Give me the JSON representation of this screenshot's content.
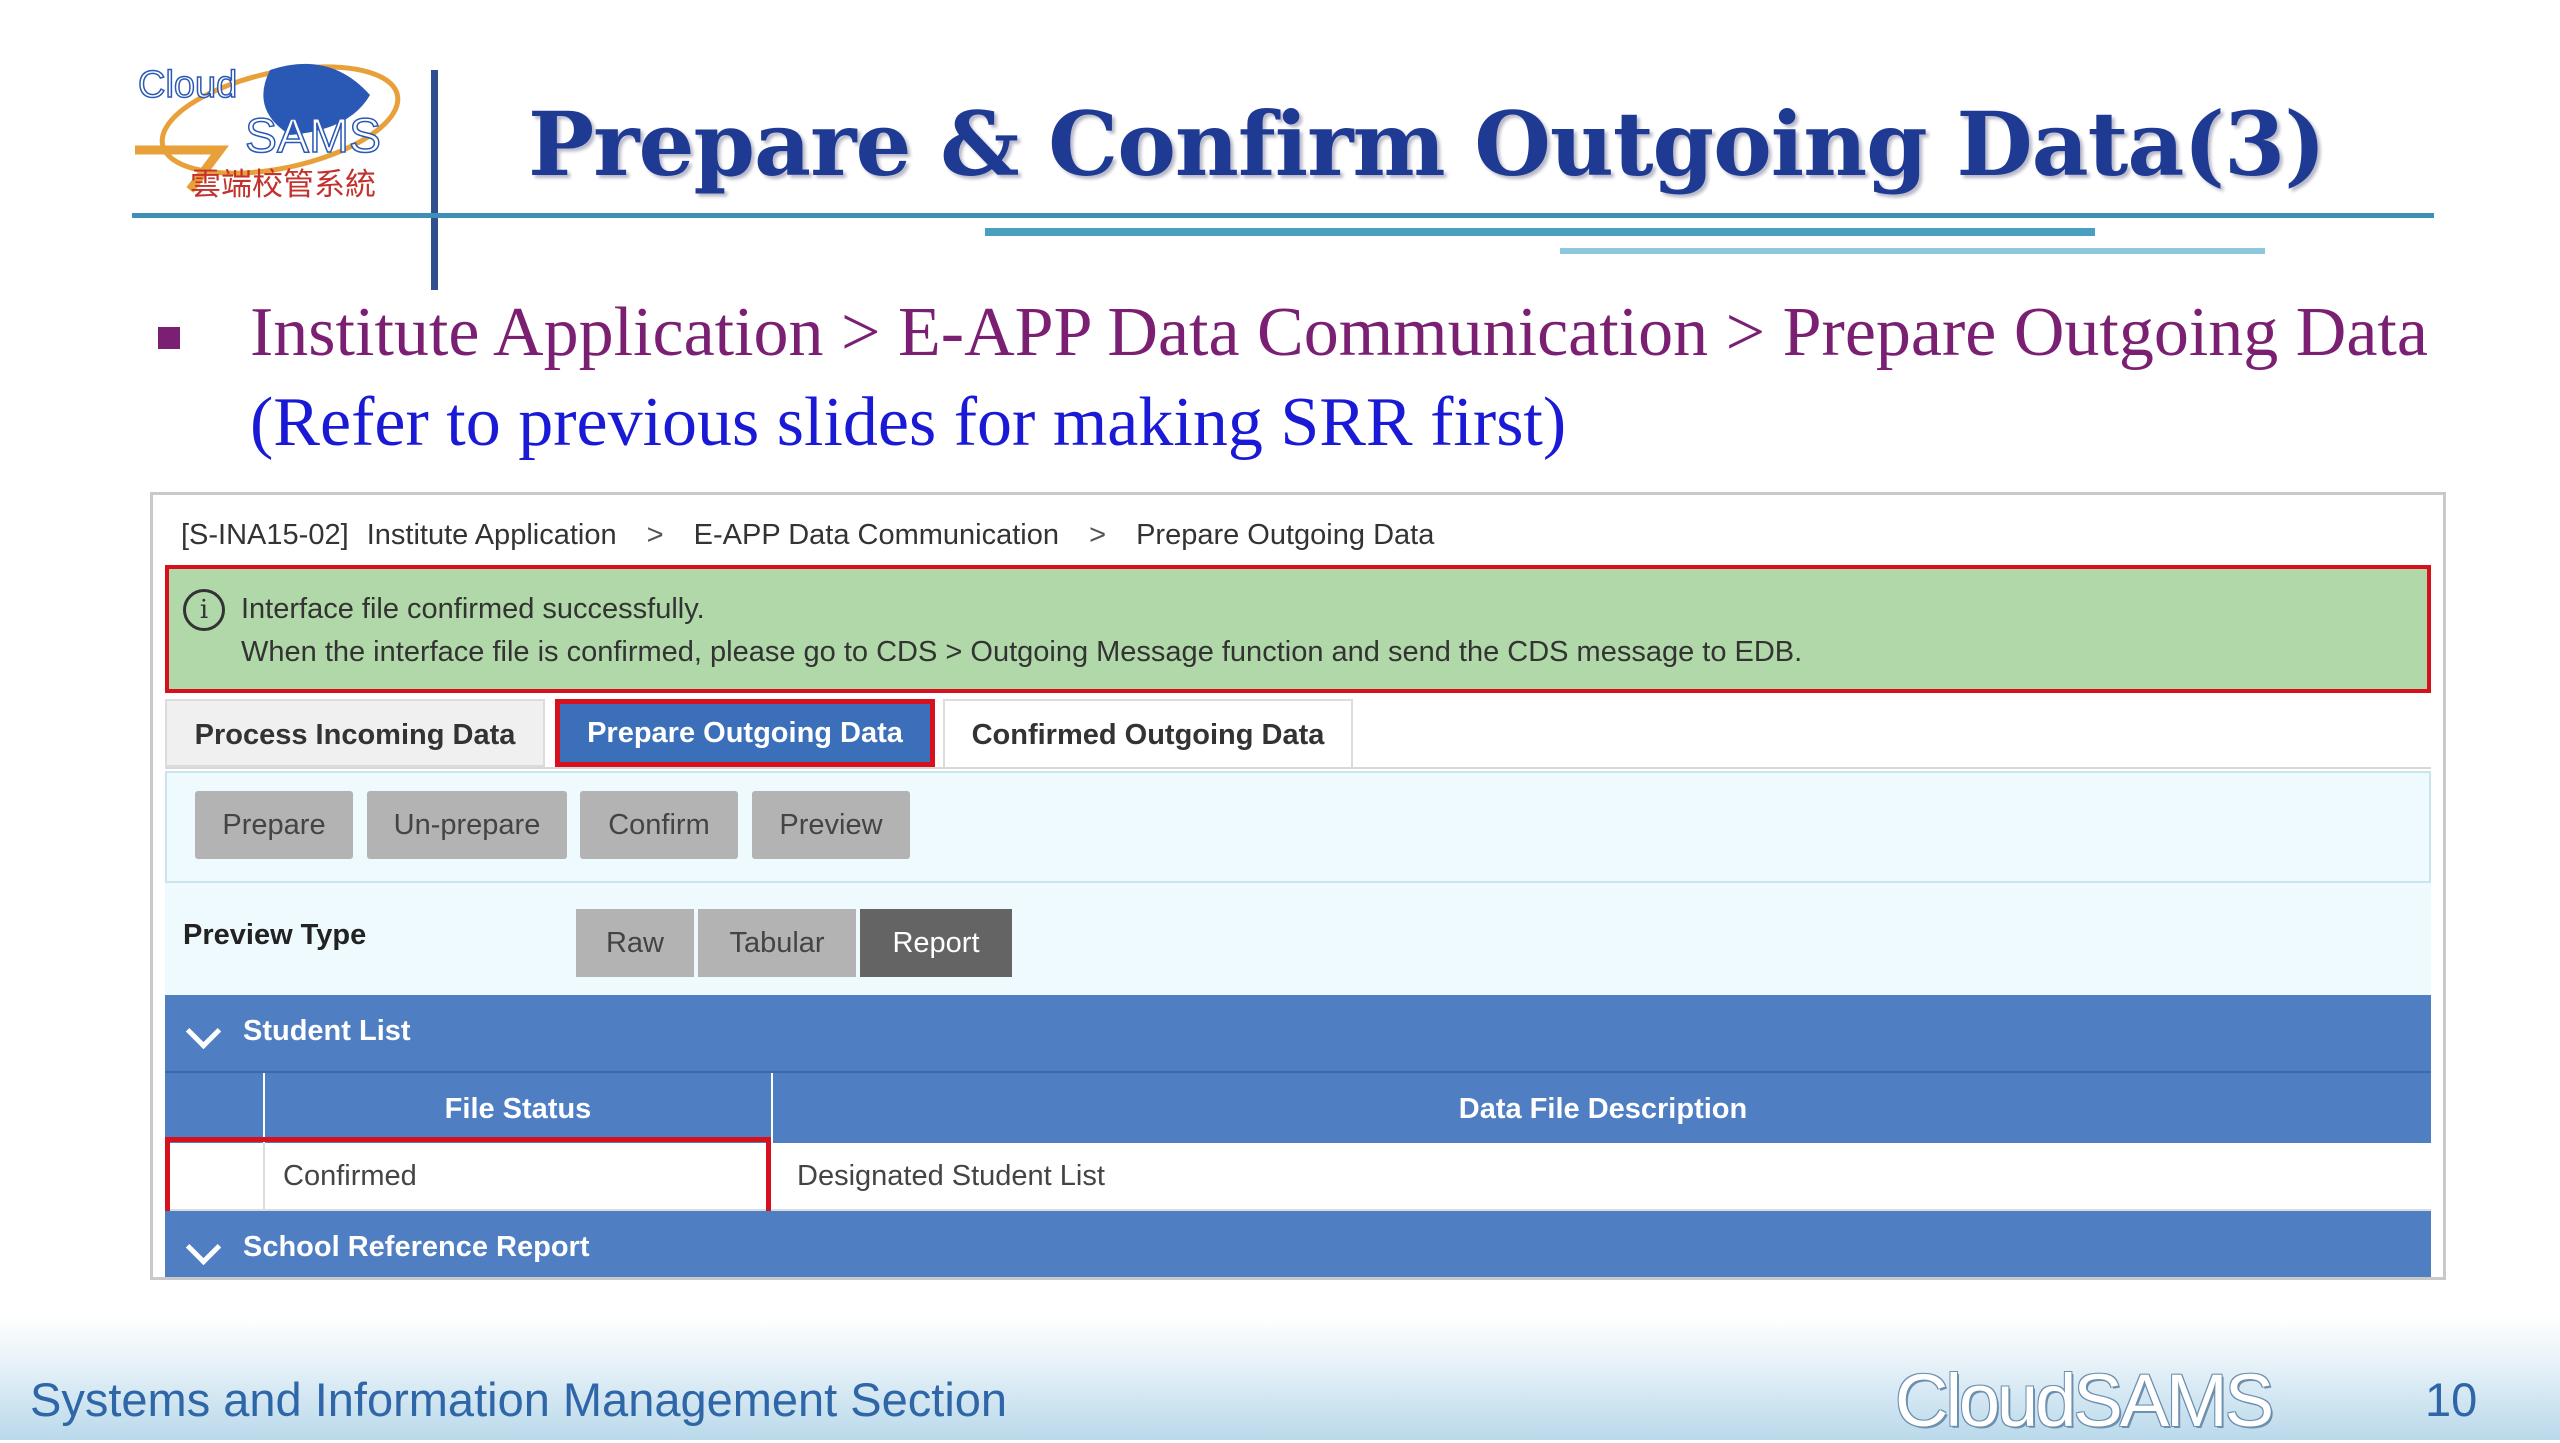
{
  "slide": {
    "title": "Prepare & Confirm Outgoing Data(3)",
    "bullet_path": "Institute Application > E-APP Data Communication > Prepare Outgoing Data",
    "bullet_note": "(Refer to previous slides for making SRR first)",
    "logo": {
      "text_en_1": "Cloud",
      "text_en_2": "SAMS",
      "text_zh": "雲端校管系統"
    }
  },
  "app": {
    "breadcrumb": {
      "code": "[S-INA15-02]",
      "items": [
        "Institute Application",
        "E-APP Data Communication",
        "Prepare Outgoing Data"
      ],
      "separator": ">"
    },
    "alert": {
      "icon": "info-icon",
      "line1": "Interface file confirmed successfully.",
      "line2": "When the interface file is confirmed, please go to CDS > Outgoing Message function and send the CDS message to EDB."
    },
    "tabs": [
      {
        "label": "Process Incoming Data",
        "active": false
      },
      {
        "label": "Prepare Outgoing Data",
        "active": true
      },
      {
        "label": "Confirmed Outgoing Data",
        "active": false
      }
    ],
    "actions": [
      "Prepare",
      "Un-prepare",
      "Confirm",
      "Preview"
    ],
    "preview_type": {
      "label": "Preview Type",
      "options": [
        "Raw",
        "Tabular",
        "Report"
      ],
      "selected": "Report"
    },
    "student_list": {
      "header": "Student List",
      "columns": [
        "",
        "File Status",
        "Data File Description"
      ],
      "rows": [
        [
          "",
          "Confirmed",
          "Designated Student List"
        ]
      ]
    },
    "srr_section": {
      "header": "School Reference Report"
    }
  },
  "footer": {
    "section": "Systems and Information Management Section",
    "brand": "CloudSAMS",
    "page": "10"
  },
  "colors": {
    "title": "#1f3a93",
    "bullet": "#7a1f72",
    "note": "#1a1ad6",
    "highlight": "#d6101c",
    "alert_bg": "#b1d8a8",
    "section_blue": "#4f7ec3"
  }
}
